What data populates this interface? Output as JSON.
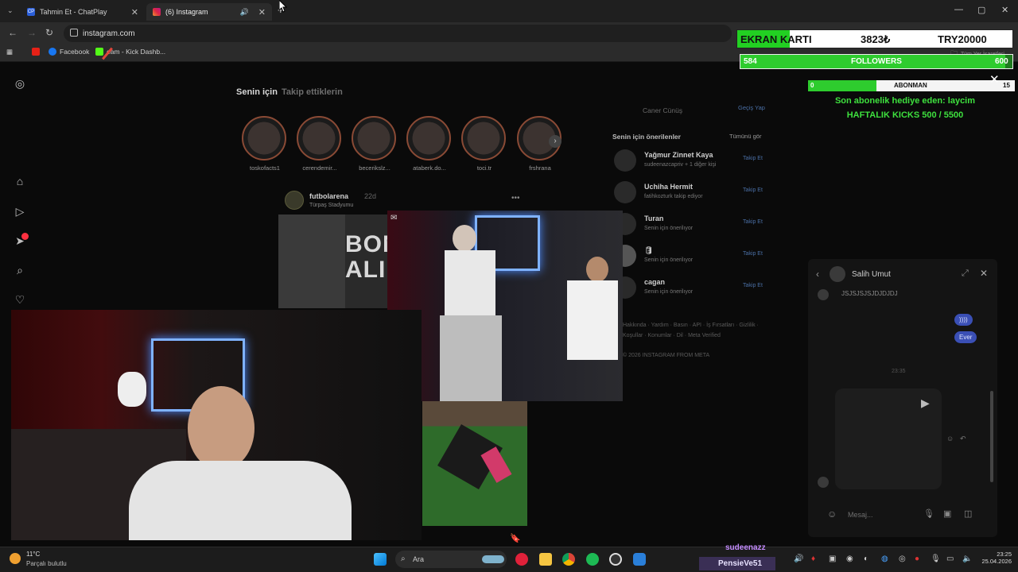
{
  "browser": {
    "tabs": [
      {
        "label": "Tahmin Et - ChatPlay",
        "favicon": "CP"
      },
      {
        "label": "(6) Instagram",
        "favicon": "instagram-icon"
      }
    ],
    "url": "instagram.com",
    "bookmarks": [
      {
        "label": "Facebook"
      },
      {
        "label": "eam - Kick Dashb..."
      }
    ],
    "bookmarks_right": "Tüm Yer İşaretleri"
  },
  "instagram": {
    "feed_tabs": [
      "Senin için",
      "Takip ettiklerin"
    ],
    "stories": [
      {
        "name": "toskofacts1"
      },
      {
        "name": "cerendemir..."
      },
      {
        "name": "becerikslz..."
      },
      {
        "name": "ataberk.do..."
      },
      {
        "name": "toci.tr"
      },
      {
        "name": "frshrana"
      }
    ],
    "post": {
      "author": "futbolarena",
      "age": "22d",
      "location": "Türpaş Stadyumu",
      "overlay_text": "BON ALINI"
    },
    "top_account": {
      "name": "Caner Cünüş",
      "action": "Geçiş Yap"
    },
    "suggestions_title": "Senin için önerilenler",
    "suggestions_all": "Tümünü gör",
    "suggestions": [
      {
        "name": "Yağmur Zinnet Kaya",
        "sub": "sudeenazcapriv + 1 diğer kişi",
        "action": "Takip Et"
      },
      {
        "name": "Uchiha Hermit",
        "sub": "fatihkozturk takip ediyor",
        "action": "Takip Et"
      },
      {
        "name": "Turan",
        "sub": "Senin için önerilıyor",
        "action": "Takip Et"
      },
      {
        "name": "🛢",
        "sub": "Senin için önerilıyor",
        "action": "Takip Et"
      },
      {
        "name": "cagan",
        "sub": "Senin için önerilıyor",
        "action": "Takip Et"
      }
    ],
    "footer_line1": "Hakkında · Yardım · Basın · API · İş Fırsatları · Gizlilik ·",
    "footer_line2": "Koşullar · Konumlar · Dil · Meta Verified",
    "footer_copy": "© 2026 INSTAGRAM FROM META"
  },
  "chat": {
    "contact": "Salih Umut",
    "incoming": "JSJSJSJSJDJDJDJ",
    "outgoing": [
      "))))",
      "Ever"
    ],
    "time": "23:35",
    "input_placeholder": "Mesaj..."
  },
  "overlay": {
    "goal_label": "EKRAN KARTI",
    "goal_current": "3823₺",
    "goal_target": "TRY20000",
    "goal_fraction": 0.19,
    "followers_current": "584",
    "followers_label": "FOLLOWERS",
    "followers_target": "600",
    "followers_fraction": 0.973,
    "subs_current": "0",
    "subs_label": "ABONMAN",
    "subs_target": "15",
    "subs_fraction": 0.33,
    "gift_line": "Son abonelik hediye eden: laycim",
    "kicks_line": "HAFTALIK KICKS 500 / 5500",
    "chat_user1": "sudeenazz",
    "chat_user2": "PensieVe51"
  },
  "taskbar": {
    "temp": "11°C",
    "weather": "Parçalı bulutlu",
    "search": "Ara",
    "time": "23:25",
    "date": "25.04.2026"
  }
}
